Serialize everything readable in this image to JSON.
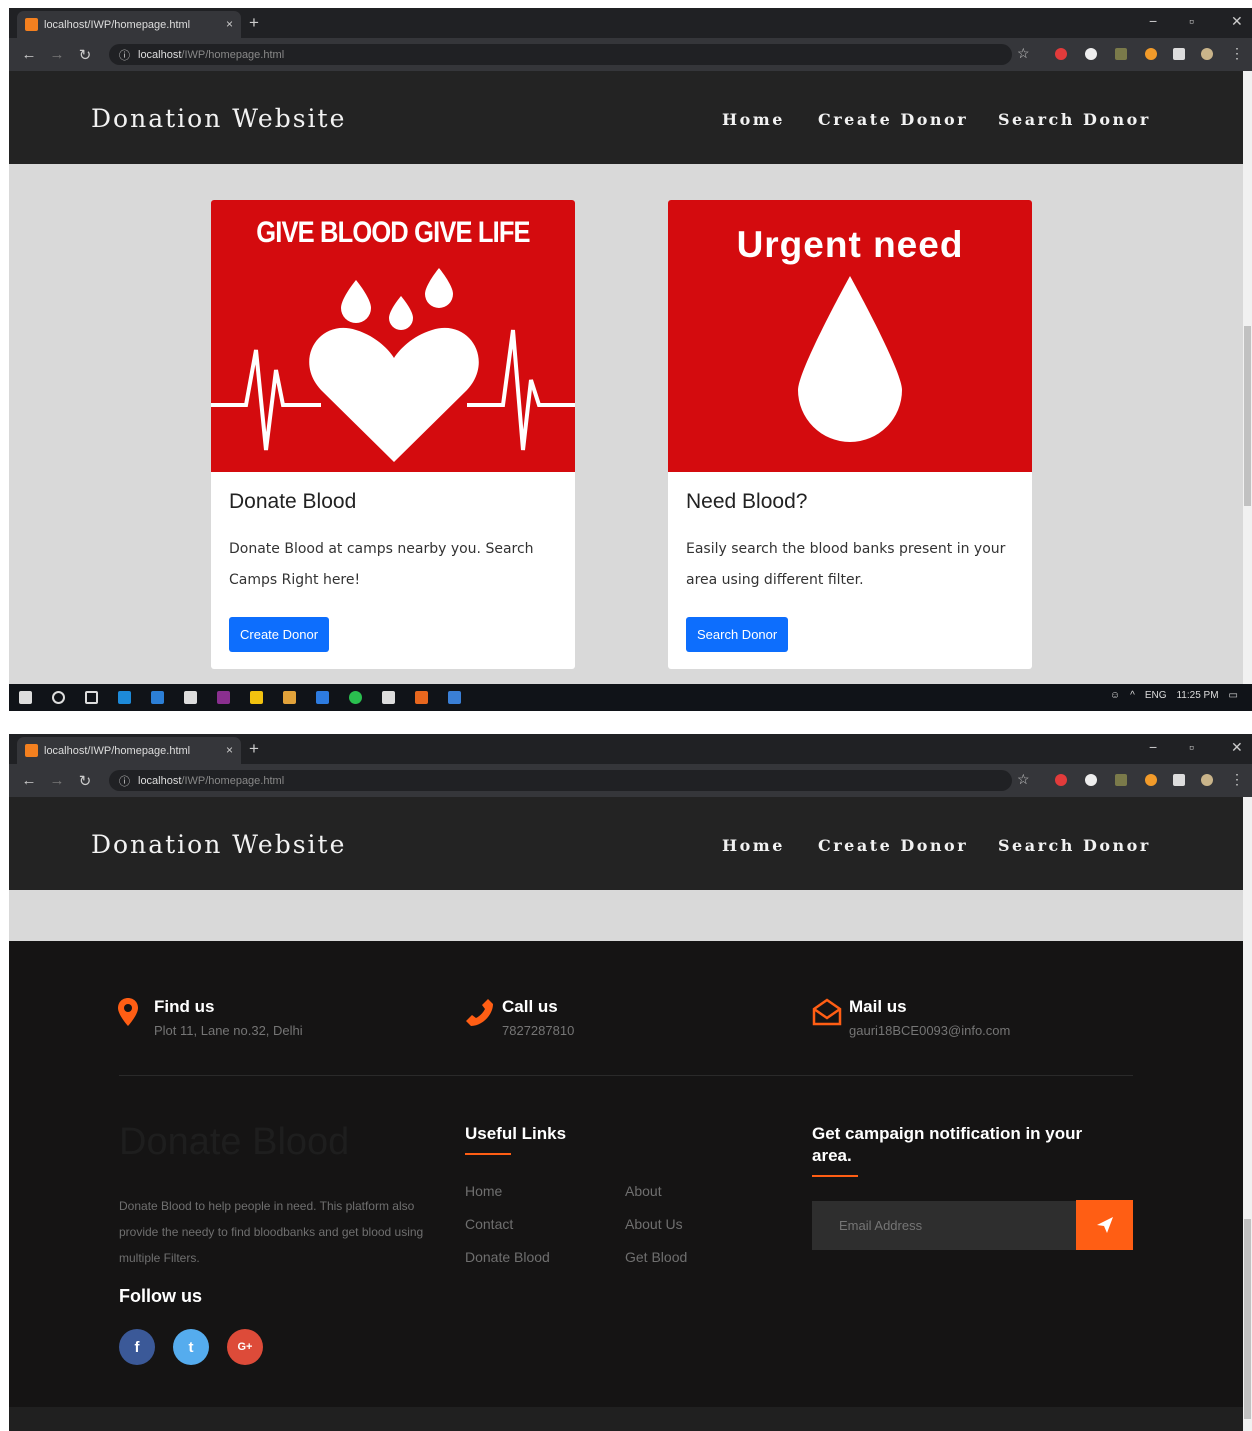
{
  "browser": {
    "tab_title": "localhost/IWP/homepage.html",
    "url_host": "localhost",
    "url_path": "/IWP/homepage.html",
    "new_tab": "+",
    "tab_close": "×",
    "minimize": "−",
    "maximize": "▫",
    "close": "✕"
  },
  "nav": {
    "brand": "Donation Website",
    "links": [
      "Home",
      "Create Donor",
      "Search Donor"
    ]
  },
  "cards": [
    {
      "image_heading": "GIVE BLOOD GIVE LIFE",
      "title": "Donate Blood",
      "text": "Donate Blood at camps nearby you. Search Camps Right here!",
      "button": "Create Donor"
    },
    {
      "image_heading": "Urgent need",
      "title": "Need Blood?",
      "text": "Easily search the blood banks present in your area using different filter.",
      "button": "Search Donor"
    }
  ],
  "taskbar": {
    "language": "ENG",
    "time": "11:25 PM"
  },
  "footer": {
    "cta": [
      {
        "icon": "map-marker-icon",
        "title": "Find us",
        "text": "Plot 11, Lane no.32, Delhi"
      },
      {
        "icon": "phone-icon",
        "title": "Call us",
        "text": "7827287810"
      },
      {
        "icon": "envelope-open-icon",
        "title": "Mail us",
        "text": "gauri18BCE0093@info.com"
      }
    ],
    "logo_text": "Donate Blood",
    "description": "Donate Blood to help people in need. This platform also provide the needy to find bloodbanks and get blood using multiple Filters.",
    "follow_title": "Follow us",
    "social": [
      "f",
      "t",
      "G+"
    ],
    "useful_links_title": "Useful Links",
    "links_col1": [
      "Home",
      "Contact",
      "Donate Blood"
    ],
    "links_col2": [
      "About",
      "About Us",
      "Get Blood"
    ],
    "subscribe_title": "Get campaign notification in your area.",
    "email_placeholder": "Email Address"
  },
  "colors": {
    "accent": "#ff5e14",
    "brand_red": "#d40b0e",
    "button_blue": "#0d6efd"
  }
}
